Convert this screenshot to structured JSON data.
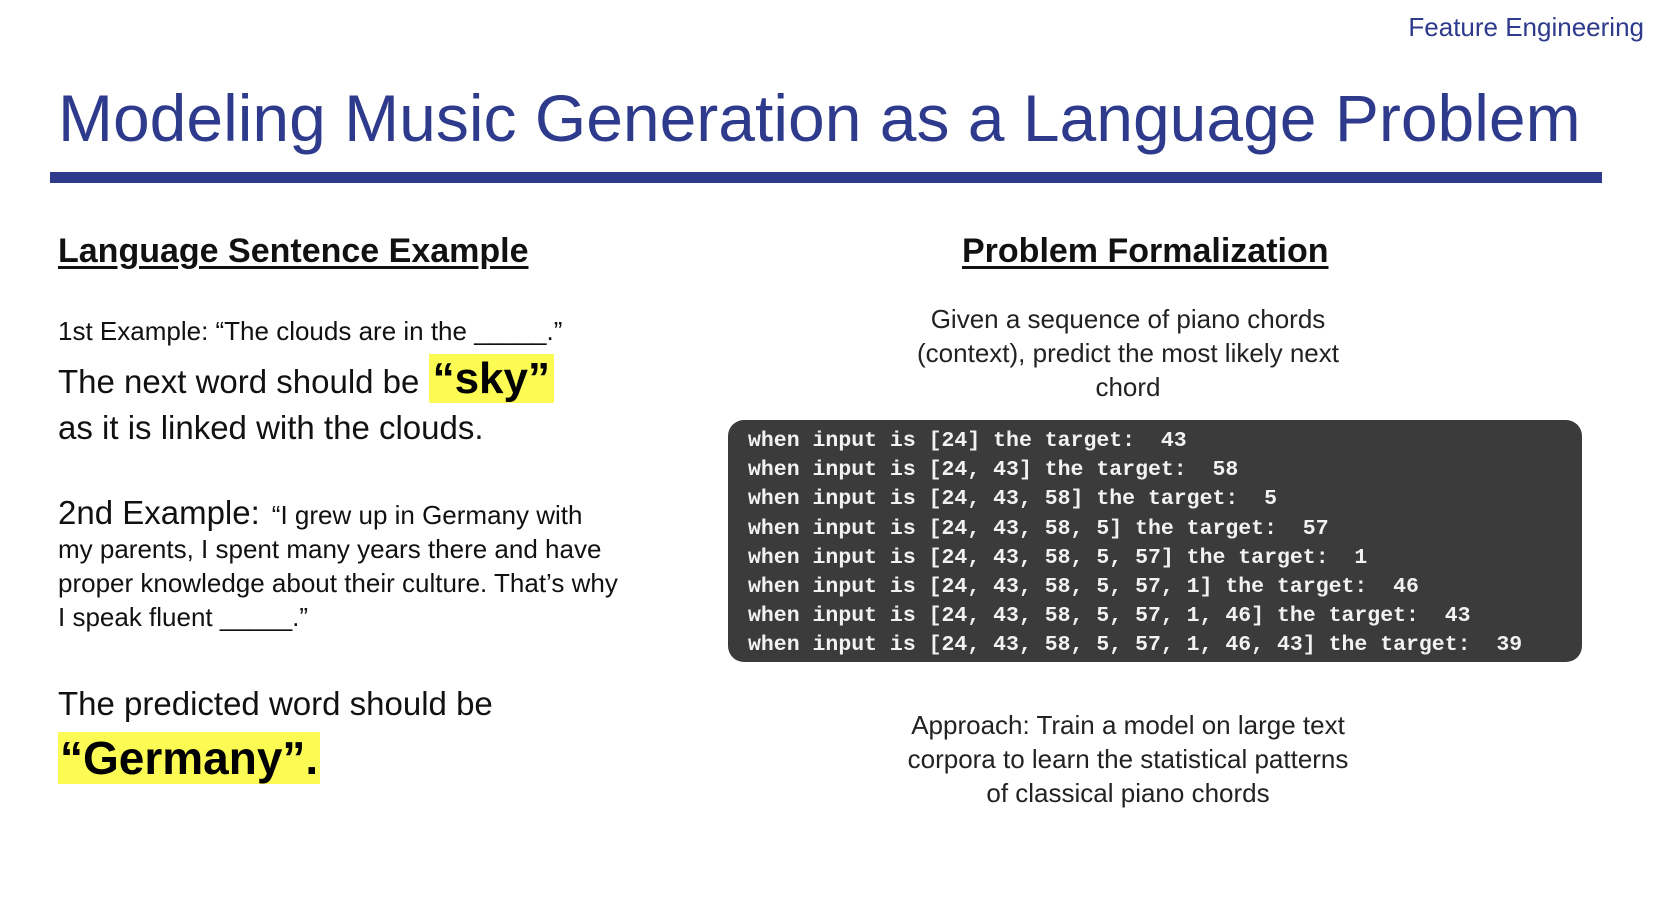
{
  "header": {
    "section": "Feature Engineering",
    "title": "Modeling Music Generation as a Language Problem"
  },
  "left": {
    "heading": "Language Sentence Example",
    "example1": {
      "prompt": "1st Example:  “The clouds are in the _____.”",
      "answer_prefix": "The next word should be ",
      "answer_highlight": "“sky”",
      "answer_suffix": "as it is linked with the clouds."
    },
    "example2": {
      "label": "2nd Example:",
      "quote": "“I grew up in Germany with my parents, I spent many years there and have proper knowledge about their culture.  That’s why I speak fluent _____.”"
    },
    "prediction": {
      "prefix": "The predicted word should be",
      "highlight": "“Germany”."
    }
  },
  "right": {
    "heading": "Problem Formalization",
    "description": "Given a sequence of piano chords (context), predict the most likely next chord",
    "code_lines": [
      "when input is [24] the target:  43",
      "when input is [24, 43] the target:  58",
      "when input is [24, 43, 58] the target:  5",
      "when input is [24, 43, 58, 5] the target:  57",
      "when input is [24, 43, 58, 5, 57] the target:  1",
      "when input is [24, 43, 58, 5, 57, 1] the target:  46",
      "when input is [24, 43, 58, 5, 57, 1, 46] the target:  43",
      "when input is [24, 43, 58, 5, 57, 1, 46, 43] the target:  39"
    ],
    "approach": "Approach: Train a model on large text corpora to learn the statistical patterns of classical piano chords"
  },
  "colors": {
    "accent": "#2e3a8c",
    "highlight": "#fbfb53",
    "code_background": "#3b3b3b"
  }
}
